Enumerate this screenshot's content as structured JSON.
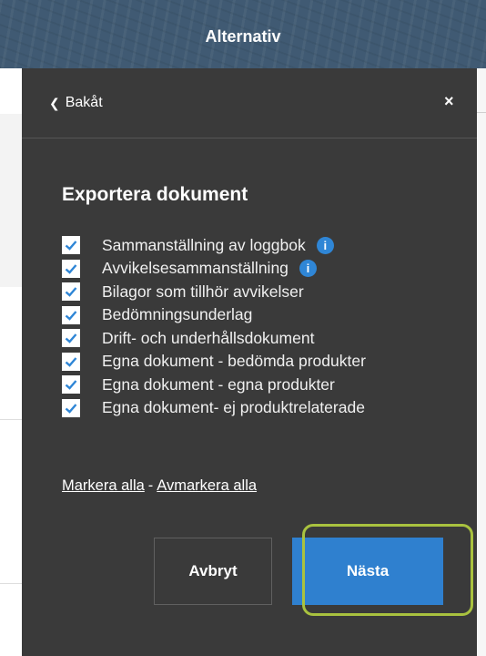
{
  "header": {
    "title": "Alternativ"
  },
  "panel": {
    "back_label": "Bakåt",
    "close_label": "×",
    "section_title": "Exportera dokument",
    "options": [
      {
        "label": "Sammanställning av loggbok",
        "checked": true,
        "info": true
      },
      {
        "label": "Avvikelsesammanställning",
        "checked": true,
        "info": true
      },
      {
        "label": "Bilagor som tillhör avvikelser",
        "checked": true,
        "info": false
      },
      {
        "label": "Bedömningsunderlag",
        "checked": true,
        "info": false
      },
      {
        "label": "Drift- och underhållsdokument",
        "checked": true,
        "info": false
      },
      {
        "label": "Egna dokument - bedömda produkter",
        "checked": true,
        "info": false
      },
      {
        "label": "Egna dokument - egna produkter",
        "checked": true,
        "info": false
      },
      {
        "label": "Egna dokument- ej produktrelaterade",
        "checked": true,
        "info": false
      }
    ],
    "info_icon_glyph": "i",
    "select_all": "Markera alla",
    "link_separator": "-",
    "deselect_all": "Avmarkera alla",
    "cancel_label": "Avbryt",
    "next_label": "Nästa"
  },
  "colors": {
    "panel_bg": "#3a3a3a",
    "accent": "#2f80cf",
    "check": "#2f86d6",
    "highlight": "#a9c23f"
  }
}
